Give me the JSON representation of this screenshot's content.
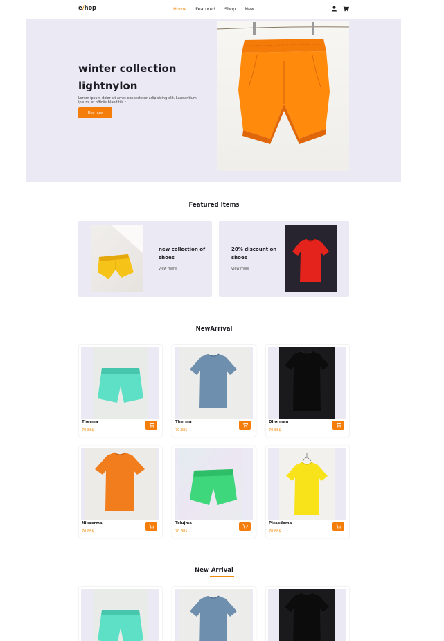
{
  "nav": {
    "logo_prefix": "e",
    "logo_accent": "/",
    "logo_suffix": "hop",
    "links": [
      "Home",
      "Featured",
      "Shop",
      "New"
    ],
    "active_link": "Home",
    "icons": [
      "user-icon",
      "cart-icon"
    ]
  },
  "hero": {
    "title_line1": "winter collection",
    "title_line2": "lightnylon",
    "description": "Lorem ipsum dolor sit amet consectetur adipisicing elit. Laudantium ipsum, et officiis blanditiis r",
    "button_label": "Buy now",
    "image": "orange-shorts-on-clothesline"
  },
  "featured": {
    "title_plain": "Featured ",
    "title_underlined": "Items",
    "cards": [
      {
        "title": "new collection of shoes",
        "link": "view more",
        "image": "yellow-shorts"
      },
      {
        "title": "20% discount on shoes",
        "link": "view more",
        "image": "red-tshirt"
      }
    ]
  },
  "new_arrival": {
    "title_plain": "New",
    "title_underlined": "Arrival",
    "products": [
      {
        "name": "Therma",
        "price": "70.88$",
        "image": "mint-shorts"
      },
      {
        "name": "Therma",
        "price": "70.88$",
        "image": "blue-tshirt"
      },
      {
        "name": "Dhorman",
        "price": "70.88$",
        "image": "black-tshirt"
      },
      {
        "name": "Nikaerma",
        "price": "70.88$",
        "image": "orange-tshirt"
      },
      {
        "name": "Tolujma",
        "price": "70.88$",
        "image": "green-shorts"
      },
      {
        "name": "Picasdoma",
        "price": "70.88$",
        "image": "yellow-tshirt"
      }
    ]
  },
  "new_arrival_2": {
    "title_plain": "New ",
    "title_underlined": "Arrival"
  },
  "colors": {
    "accent": "#f47e09",
    "hero_bg": "#ebe9f3",
    "text_dark": "#1b1b22"
  }
}
